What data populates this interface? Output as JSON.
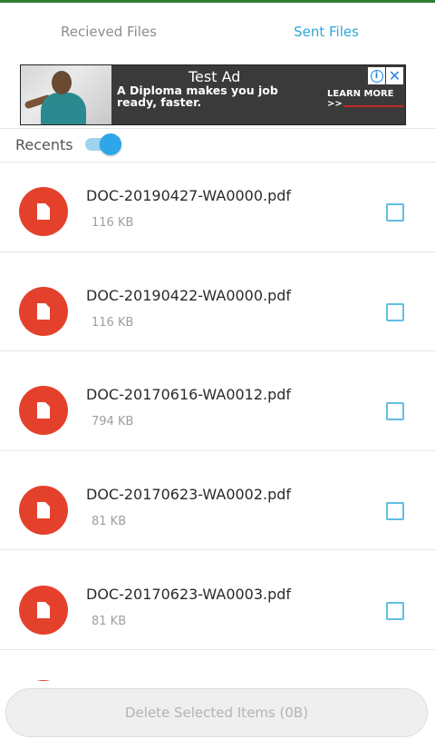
{
  "tabs": [
    {
      "label": "Recieved Files",
      "active": false
    },
    {
      "label": "Sent Files",
      "active": true
    }
  ],
  "ad": {
    "title": "Test Ad",
    "text": "A Diploma makes you job ready, faster.",
    "cta": "LEARN MORE >>",
    "info_glyph": "i",
    "close_glyph": "✕"
  },
  "recents": {
    "label": "Recents",
    "toggle_on": true
  },
  "files": [
    {
      "name": "DOC-20190427-WA0000.pdf",
      "size": "116 KB",
      "checked": false
    },
    {
      "name": "DOC-20190422-WA0000.pdf",
      "size": "116 KB",
      "checked": false
    },
    {
      "name": "DOC-20170616-WA0012.pdf",
      "size": "794 KB",
      "checked": false
    },
    {
      "name": "DOC-20170623-WA0002.pdf",
      "size": "81 KB",
      "checked": false
    },
    {
      "name": "DOC-20170623-WA0003.pdf",
      "size": "81 KB",
      "checked": false
    }
  ],
  "footer": {
    "delete_label": "Delete Selected Items (0B)"
  },
  "colors": {
    "accent": "#2ea6d9",
    "file_icon": "#e4412c",
    "status_bar": "#2e7d32"
  }
}
